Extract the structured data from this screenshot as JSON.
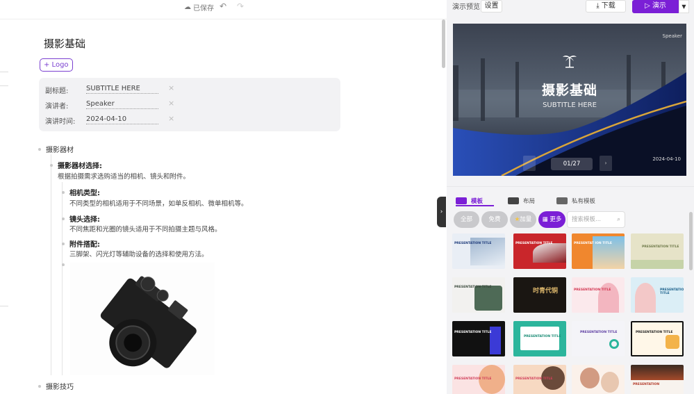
{
  "editor": {
    "saved_status": "已保存",
    "title": "摄影基础",
    "logo_button": "+ Logo",
    "meta": [
      {
        "label": "副标题:",
        "value": "SUBTITLE HERE"
      },
      {
        "label": "演讲者:",
        "value": "Speaker"
      },
      {
        "label": "演讲时间:",
        "value": "2024-04-10"
      }
    ],
    "outline": {
      "section1": "摄影器材",
      "item1_title": "摄影器材选择:",
      "item1_desc": "根据拍摄需求选购适当的相机、镜头和附件。",
      "sub1_title": "相机类型:",
      "sub1_desc": "不同类型的相机适用于不同场景，如单反相机、微单相机等。",
      "sub2_title": "镜头选择:",
      "sub2_desc": "不同焦距和光圈的镜头适用于不同拍摄主题与风格。",
      "sub3_title": "附件搭配:",
      "sub3_desc": "三脚架、闪光灯等辅助设备的选择和使用方法。",
      "section2": "摄影技巧"
    }
  },
  "preview": {
    "label": "演示预览",
    "settings_button": "设置",
    "download_button": "下载",
    "present_button": "演示",
    "slide": {
      "speaker": "Speaker",
      "title": "摄影基础",
      "subtitle": "SUBTITLE HERE",
      "date": "2024-04-10",
      "counter": "01/27"
    }
  },
  "tabs": [
    {
      "label": "模板",
      "icon": "template-icon"
    },
    {
      "label": "布局",
      "icon": "layout-icon"
    },
    {
      "label": "私有模板",
      "icon": "private-template-icon"
    }
  ],
  "filters": {
    "all": "全部",
    "free": "免费",
    "plus": "加量",
    "more": "更多",
    "search_placeholder": "搜索模板..."
  },
  "templates": [
    {
      "label": "PRESENTATION TITLE",
      "bg": "#e9eef5"
    },
    {
      "label": "PRESENTATION TITLE",
      "bg": "#c9262b"
    },
    {
      "label": "PRESENTAT ION TITLE",
      "bg": "#f0872e"
    },
    {
      "label": "PRESENTATION TITLE",
      "bg": "#e6e3c8"
    },
    {
      "label": "PRESENTATION TITLE",
      "bg": "#f2f1ef"
    },
    {
      "label": "时青代铜",
      "bg": "#1a1612"
    },
    {
      "label": "PRESENTATION TITLE",
      "bg": "#fbe9ec"
    },
    {
      "label": "PRESENTATION TITLE",
      "bg": "#dbeef6"
    },
    {
      "label": "PRESENTATION TITLE",
      "bg": "#111111"
    },
    {
      "label": "PRESENTATION TITLE",
      "bg": "#2cb59c"
    },
    {
      "label": "PRESENTATION TITLE",
      "bg": "#f4f4f8"
    },
    {
      "label": "PRESENTATION TITLE",
      "bg": "#fff7e8"
    },
    {
      "label": "PRESENTATION TITLE",
      "bg": "#fbe3e3"
    },
    {
      "label": "PRESENTATION TITLE",
      "bg": "#f7d9c2"
    },
    {
      "label": "",
      "bg": "#fbf1ea"
    },
    {
      "label": "PRESENTATION",
      "bg": "#f8f3ee"
    }
  ],
  "colors": {
    "accent": "#7b1fd6"
  }
}
